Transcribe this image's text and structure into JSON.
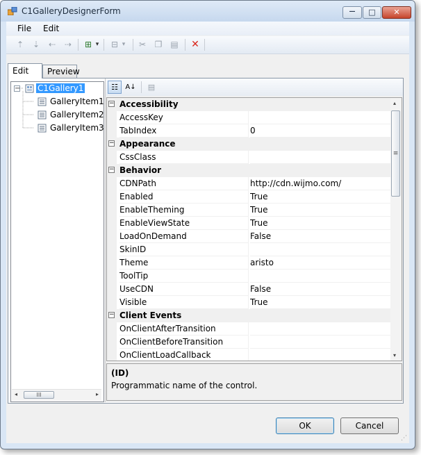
{
  "window": {
    "title": "C1GalleryDesignerForm",
    "minimize_glyph": "—",
    "maximize_glyph": "□",
    "close_glyph": "✕"
  },
  "menu": [
    "File",
    "Edit"
  ],
  "toolbar": {
    "icons": [
      "move-top-icon",
      "move-bottom-icon",
      "move-up-icon",
      "move-down-icon",
      "add-child-icon",
      "insert-item-icon",
      "cut-icon",
      "copy-icon",
      "paste-icon",
      "delete-icon"
    ],
    "glyphs": {
      "move_top": "⇡",
      "move_bottom": "⇣",
      "move_left": "⇠",
      "move_right": "⇢",
      "add_child": "⊞",
      "dropdown": "▾",
      "insert": "⊟",
      "cut": "✂",
      "copy": "❐",
      "paste": "▤",
      "delete": "✕"
    },
    "delete_color": "#d9261c"
  },
  "tabs": [
    "Edit",
    "Preview"
  ],
  "tree": {
    "root": "C1Gallery1",
    "children": [
      "GalleryItem1",
      "GalleryItem2",
      "GalleryItem3"
    ],
    "expander": "−",
    "scroll": {
      "left": "◂",
      "right": "▸",
      "thumb": "III"
    }
  },
  "property_grid": {
    "toolbar": {
      "categorized": "☷",
      "alphabetical": "A↓",
      "pages": "▤"
    },
    "rows": [
      {
        "type": "category",
        "name": "Accessibility"
      },
      {
        "type": "prop",
        "name": "AccessKey",
        "value": ""
      },
      {
        "type": "prop",
        "name": "TabIndex",
        "value": "0"
      },
      {
        "type": "category",
        "name": "Appearance"
      },
      {
        "type": "prop",
        "name": "CssClass",
        "value": ""
      },
      {
        "type": "category",
        "name": "Behavior"
      },
      {
        "type": "prop",
        "name": "CDNPath",
        "value": "http://cdn.wijmo.com/"
      },
      {
        "type": "prop",
        "name": "Enabled",
        "value": "True"
      },
      {
        "type": "prop",
        "name": "EnableTheming",
        "value": "True"
      },
      {
        "type": "prop",
        "name": "EnableViewState",
        "value": "True"
      },
      {
        "type": "prop",
        "name": "LoadOnDemand",
        "value": "False"
      },
      {
        "type": "prop",
        "name": "SkinID",
        "value": ""
      },
      {
        "type": "prop",
        "name": "Theme",
        "value": "aristo"
      },
      {
        "type": "prop",
        "name": "ToolTip",
        "value": ""
      },
      {
        "type": "prop",
        "name": "UseCDN",
        "value": "False"
      },
      {
        "type": "prop",
        "name": "Visible",
        "value": "True"
      },
      {
        "type": "category",
        "name": "Client Events"
      },
      {
        "type": "prop",
        "name": "OnClientAfterTransition",
        "value": ""
      },
      {
        "type": "prop",
        "name": "OnClientBeforeTransition",
        "value": ""
      },
      {
        "type": "prop",
        "name": "OnClientLoadCallback",
        "value": ""
      }
    ],
    "collapse_glyph": "−",
    "scroll": {
      "up": "▴",
      "down": "▾",
      "thumb": "≡"
    }
  },
  "help": {
    "title": "(ID)",
    "description": "Programmatic name of the control."
  },
  "buttons": {
    "ok": "OK",
    "cancel": "Cancel"
  },
  "grip_glyph": "⋰",
  "colors": {
    "selection": "#3399ff",
    "titlebar": "#c6d8ee",
    "close_button": "#c7452c"
  }
}
